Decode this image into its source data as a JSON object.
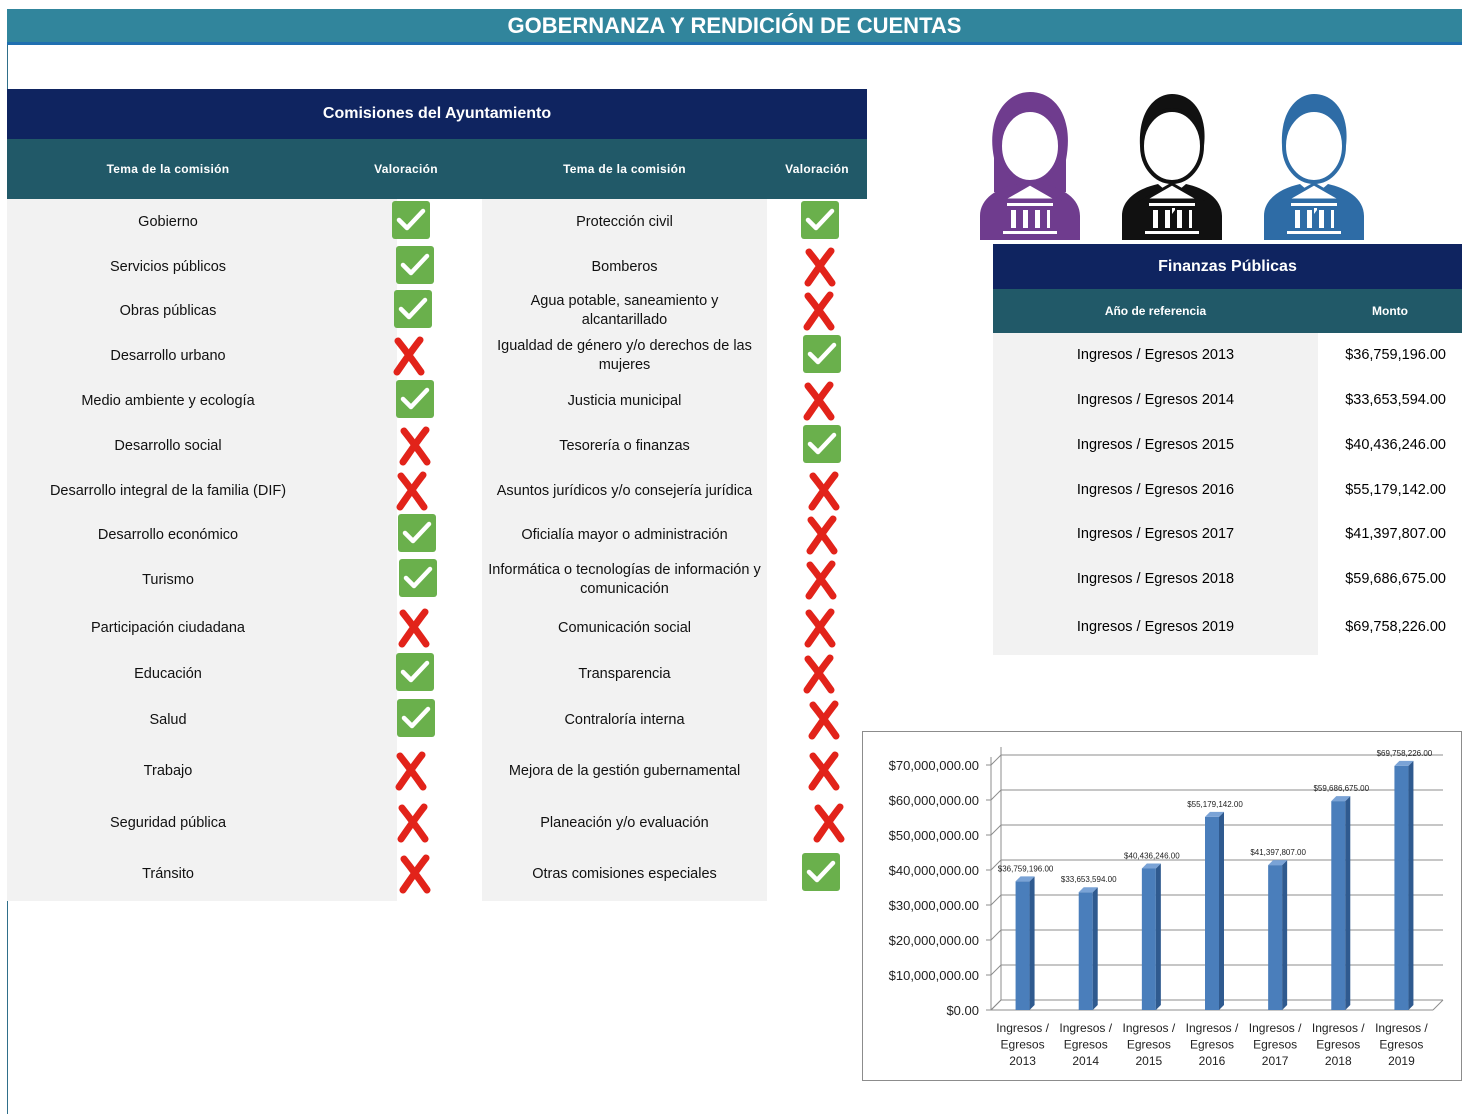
{
  "page": {
    "title": "GOBERNANZA Y RENDICIÓN DE CUENTAS"
  },
  "commissions": {
    "title": "Comisiones del Ayuntamiento",
    "headers": {
      "topic_left": "Tema de la comisión",
      "rating_left": "Valoración",
      "topic_right": "Tema de la comisión",
      "rating_right": "Valoración"
    },
    "left": [
      {
        "topic": "Gobierno",
        "value": true
      },
      {
        "topic": "Servicios públicos",
        "value": true
      },
      {
        "topic": "Obras públicas",
        "value": true
      },
      {
        "topic": "Desarrollo urbano",
        "value": false
      },
      {
        "topic": "Medio ambiente y ecología",
        "value": true
      },
      {
        "topic": "Desarrollo social",
        "value": false
      },
      {
        "topic": "Desarrollo integral de la familia (DIF)",
        "value": false
      },
      {
        "topic": "Desarrollo económico",
        "value": true
      },
      {
        "topic": "Turismo",
        "value": true
      },
      {
        "topic": "Participación ciudadana",
        "value": false
      },
      {
        "topic": "Educación",
        "value": true
      },
      {
        "topic": "Salud",
        "value": true
      },
      {
        "topic": "Trabajo",
        "value": false
      },
      {
        "topic": "Seguridad pública",
        "value": false
      },
      {
        "topic": "Tránsito",
        "value": false
      }
    ],
    "right": [
      {
        "topic": "Protección civil",
        "value": true
      },
      {
        "topic": "Bomberos",
        "value": false
      },
      {
        "topic": "Agua potable, saneamiento y alcantarillado",
        "value": false
      },
      {
        "topic": "Igualdad de género y/o derechos de las mujeres",
        "value": true
      },
      {
        "topic": "Justicia municipal",
        "value": false
      },
      {
        "topic": "Tesorería o finanzas",
        "value": true
      },
      {
        "topic": "Asuntos jurídicos y/o consejería jurídica",
        "value": false
      },
      {
        "topic": "Oficialía mayor o administración",
        "value": false
      },
      {
        "topic": "Informática o tecnologías de información y comunicación",
        "value": false
      },
      {
        "topic": "Comunicación social",
        "value": false
      },
      {
        "topic": "Transparencia",
        "value": false
      },
      {
        "topic": "Contraloría interna",
        "value": false
      },
      {
        "topic": "Mejora de la gestión gubernamental",
        "value": false
      },
      {
        "topic": "Planeación y/o evaluación",
        "value": false
      },
      {
        "topic": "Otras comisiones especiales",
        "value": true
      }
    ]
  },
  "finance": {
    "title": "Finanzas Públicas",
    "headers": {
      "year": "Año de referencia",
      "amount": "Monto"
    },
    "rows": [
      {
        "label": "Ingresos / Egresos 2013",
        "amount": "$36,759,196.00"
      },
      {
        "label": "Ingresos / Egresos 2014",
        "amount": "$33,653,594.00"
      },
      {
        "label": "Ingresos / Egresos 2015",
        "amount": "$40,436,246.00"
      },
      {
        "label": "Ingresos / Egresos 2016",
        "amount": "$55,179,142.00"
      },
      {
        "label": "Ingresos / Egresos 2017",
        "amount": "$41,397,807.00"
      },
      {
        "label": "Ingresos / Egresos 2018",
        "amount": "$59,686,675.00"
      },
      {
        "label": "Ingresos / Egresos 2019",
        "amount": "$69,758,226.00"
      }
    ]
  },
  "icons": {
    "avatars": [
      "female-official-icon",
      "male-official-icon",
      "male-official-icon"
    ],
    "check": "check-icon",
    "cross": "cross-icon"
  },
  "colors": {
    "title_bar": "#31859c",
    "navy": "#0f2460",
    "teal_header": "#215968",
    "check": "#6ab04c",
    "cross": "#e2231a",
    "bar": "#4a7ebb",
    "avatar_female": "#6f3c8e",
    "avatar_male_black": "#111111",
    "avatar_male_blue": "#2e6ca6"
  },
  "chart_data": {
    "type": "bar",
    "categories": [
      [
        "Ingresos /",
        "Egresos",
        "2013"
      ],
      [
        "Ingresos /",
        "Egresos",
        "2014"
      ],
      [
        "Ingresos /",
        "Egresos",
        "2015"
      ],
      [
        "Ingresos /",
        "Egresos",
        "2016"
      ],
      [
        "Ingresos /",
        "Egresos",
        "2017"
      ],
      [
        "Ingresos /",
        "Egresos",
        "2018"
      ],
      [
        "Ingresos /",
        "Egresos",
        "2019"
      ]
    ],
    "values": [
      36759196,
      33653594,
      40436246,
      55179142,
      41397807,
      59686675,
      69758226
    ],
    "data_labels": [
      "$36,759,196.00",
      "$33,653,594.00",
      "$40,436,246.00",
      "$55,179,142.00",
      "$41,397,807.00",
      "$59,686,675.00",
      "$69,758,226.00"
    ],
    "y_ticks": [
      0,
      10000000,
      20000000,
      30000000,
      40000000,
      50000000,
      60000000,
      70000000
    ],
    "y_tick_labels": [
      "$0.00",
      "$10,000,000.00",
      "$20,000,000.00",
      "$30,000,000.00",
      "$40,000,000.00",
      "$50,000,000.00",
      "$60,000,000.00",
      "$70,000,000.00"
    ],
    "ylim": [
      0,
      70000000
    ],
    "grid": true,
    "legend": false,
    "style": "3d-column"
  }
}
